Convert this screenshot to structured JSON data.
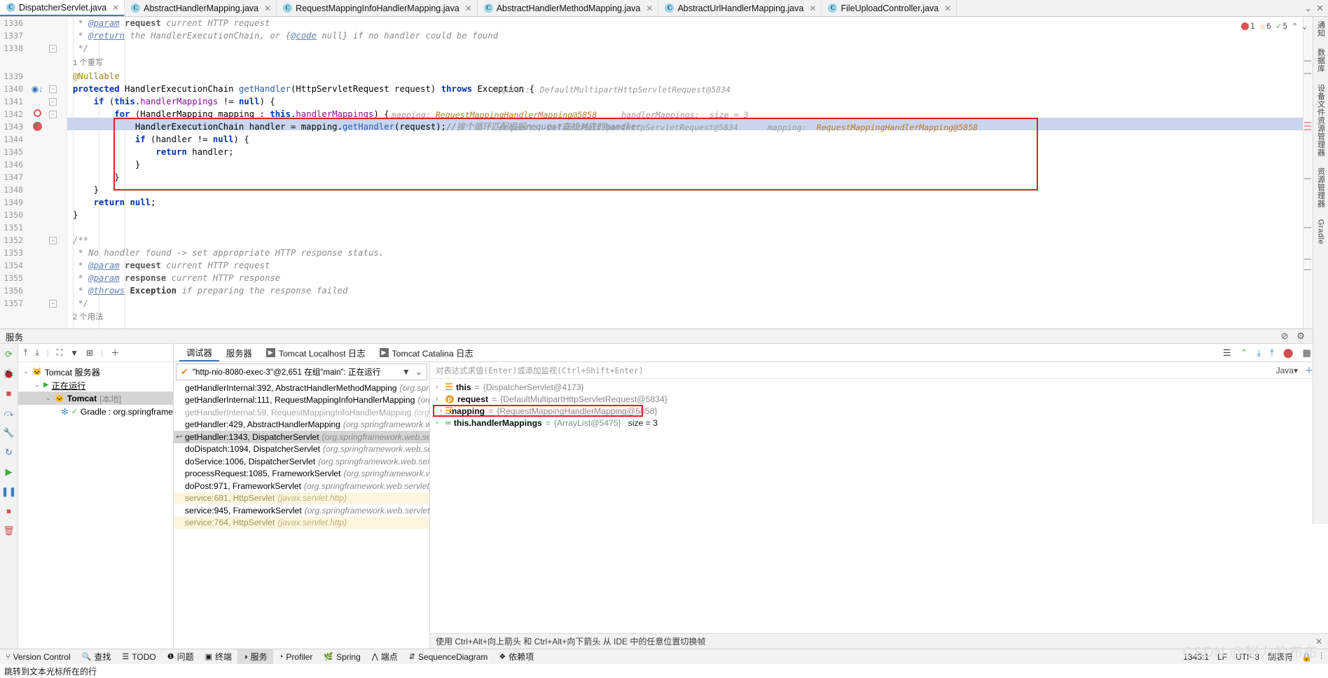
{
  "tabs": [
    {
      "label": "DispatcherServlet.java",
      "active": true
    },
    {
      "label": "AbstractHandlerMapping.java",
      "active": false
    },
    {
      "label": "RequestMappingInfoHandlerMapping.java",
      "active": false
    },
    {
      "label": "AbstractHandlerMethodMapping.java",
      "active": false
    },
    {
      "label": "AbstractUrlHandlerMapping.java",
      "active": false
    },
    {
      "label": "FileUploadController.java",
      "active": false
    }
  ],
  "inspections": {
    "errors": "1",
    "warnings": "6",
    "weak": "5",
    "up": "⌃",
    "down": "⌄"
  },
  "editor": {
    "lines": [
      {
        "no": "1336",
        "text": " * @param request current HTTP request"
      },
      {
        "no": "1337",
        "text": " * @return the HandlerExecutionChain, or {@code null} if no handler could be found"
      },
      {
        "no": "1338",
        "text": " */"
      },
      {
        "no": "",
        "text": "1 个重写"
      },
      {
        "no": "1339",
        "text": "@Nullable"
      },
      {
        "no": "1340",
        "text": "protected HandlerExecutionChain getHandler(HttpServletRequest request) throws Exception {"
      },
      {
        "no": "1341",
        "text": "if (this.handlerMappings != null) {"
      },
      {
        "no": "1342",
        "text": "for (HandlerMapping mapping : this.handlerMappings) {"
      },
      {
        "no": "1343",
        "text": "HandlerExecutionChain handler = mapping.getHandler(request);"
      },
      {
        "no": "1344",
        "text": "if (handler != null) {"
      },
      {
        "no": "1345",
        "text": "return handler;"
      },
      {
        "no": "1346",
        "text": "}"
      },
      {
        "no": "1347",
        "text": "}"
      },
      {
        "no": "1348",
        "text": "}"
      },
      {
        "no": "1349",
        "text": "return null;"
      },
      {
        "no": "1350",
        "text": "}"
      },
      {
        "no": "1351",
        "text": ""
      },
      {
        "no": "1352",
        "text": "/**"
      },
      {
        "no": "1353",
        "text": " * No handler found -> set appropriate HTTP response status."
      },
      {
        "no": "1354",
        "text": " * @param request current HTTP request"
      },
      {
        "no": "1355",
        "text": " * @param response current HTTP response"
      },
      {
        "no": "1356",
        "text": " * @throws Exception if preparing the response failed"
      },
      {
        "no": "1357",
        "text": " */"
      },
      {
        "no": "",
        "text": "2 个用法"
      }
    ],
    "override_label_1": "1 个重写",
    "usages_label": "2 个用法",
    "line1343_comment": "//挨个循环匹配根据request查找对应的handler",
    "hint_1340_request": "request:  DefaultMultipartHttpServletRequest@5834",
    "hint_1342_mapping": "mapping:  RequestMappingHandlerMapping@5858",
    "hint_1342_handlerMappings": "handlerMappings:  size = 3",
    "hint_1343_request": "request:  DefaultMultipartHttpServletRequest@5834",
    "hint_1343_mapping": "mapping:  RequestMappingHandlerMapping@5858"
  },
  "right_strip": [
    "通知",
    "数据库",
    "设备文件资源管理器",
    "资源管理器",
    "Gradle"
  ],
  "services": {
    "title": "服务",
    "tree_toolbar_icons": [
      "expand-all-icon",
      "collapse-all-icon",
      "group-icon",
      "filter-icon",
      "add-frame-icon",
      "plus-icon"
    ],
    "tree": [
      {
        "label": "Tomcat 服务器",
        "depth": 0,
        "icon": "tomcat-icon",
        "twisty": "⌄",
        "selected": false,
        "bold": false
      },
      {
        "label": "正在运行",
        "depth": 1,
        "icon": "play-icon",
        "twisty": "⌄",
        "selected": false,
        "bold": false,
        "underline": true
      },
      {
        "label": "Tomcat",
        "suffix": "[本地]",
        "depth": 2,
        "icon": "tomcat-icon",
        "twisty": "⌄",
        "selected": true,
        "bold": true
      },
      {
        "label": "Gradle : org.springframe",
        "depth": 3,
        "icon": "gradle-icon",
        "twisty": "",
        "selected": false,
        "bold": false
      }
    ]
  },
  "debugger": {
    "tabs": [
      {
        "label": "调试器",
        "active": true,
        "badge": ""
      },
      {
        "label": "服务器",
        "active": false,
        "badge": ""
      },
      {
        "label": "Tomcat Localhost 日志",
        "active": false,
        "badge": "▶"
      },
      {
        "label": "Tomcat Catalina 日志",
        "active": false,
        "badge": "▶"
      }
    ],
    "thread": "\"http-nio-8080-exec-3\"@2,651 在组\"main\": 正在运行",
    "frames": [
      {
        "method": "getHandlerInternal:392, AbstractHandlerMethodMapping",
        "pkg": "(org.springfra",
        "state": "normal"
      },
      {
        "method": "getHandlerInternal:111, RequestMappingInfoHandlerMapping",
        "pkg": "(org.sprin",
        "state": "normal"
      },
      {
        "method": "getHandlerInternal:59, RequestMappingInfoHandlerMapping",
        "pkg": "(org.sprin",
        "state": "gray"
      },
      {
        "method": "getHandler:429, AbstractHandlerMapping",
        "pkg": "(org.springframework.web.se",
        "state": "normal"
      },
      {
        "method": "getHandler:1343, DispatcherServlet",
        "pkg": "(org.springframework.web.servlet)",
        "state": "selected"
      },
      {
        "method": "doDispatch:1094, DispatcherServlet",
        "pkg": "(org.springframework.web.servlet)",
        "state": "normal"
      },
      {
        "method": "doService:1006, DispatcherServlet",
        "pkg": "(org.springframework.web.servlet)",
        "state": "normal"
      },
      {
        "method": "processRequest:1085, FrameworkServlet",
        "pkg": "(org.springframework.web.ser",
        "state": "normal"
      },
      {
        "method": "doPost:971, FrameworkServlet",
        "pkg": "(org.springframework.web.servlet)",
        "state": "normal"
      },
      {
        "method": "service:681, HttpServlet",
        "pkg": "(javax.servlet.http)",
        "state": "yellow"
      },
      {
        "method": "service:945, FrameworkServlet",
        "pkg": "(org.springframework.web.servlet)",
        "state": "normal"
      },
      {
        "method": "service:764, HttpServlet",
        "pkg": "(javax.servlet.http)",
        "state": "yellow"
      }
    ],
    "eval_placeholder": "对表达式求值(Enter)或添加监视(Ctrl+Shift+Enter)",
    "eval_lang": "Java",
    "variables": [
      {
        "name": "this",
        "eq": "=",
        "value": "{DispatcherServlet@4173}",
        "icon": "object-icon",
        "extra": "",
        "boxed": false
      },
      {
        "name": "request",
        "eq": "=",
        "value": "{DefaultMultipartHttpServletRequest@5834}",
        "icon": "parameter-icon",
        "extra": "",
        "boxed": false
      },
      {
        "name": "mapping",
        "eq": "=",
        "value": "{RequestMappingHandlerMapping@5858}",
        "icon": "object-icon",
        "extra": "",
        "boxed": true
      },
      {
        "name": "this.handlerMappings",
        "eq": "=",
        "value": "{ArrayList@5475}",
        "icon": "watch-icon",
        "extra": "size = 3",
        "boxed": false
      }
    ],
    "footer_hint": "使用 Ctrl+Alt+向上箭头 和 Ctrl+Alt+向下箭头 从 IDE 中的任意位置切换帧"
  },
  "statusbar": {
    "items": [
      {
        "label": "Version Control",
        "icon": "branch-icon",
        "active": false
      },
      {
        "label": "查找",
        "icon": "search-icon",
        "active": false
      },
      {
        "label": "TODO",
        "icon": "list-icon",
        "active": false
      },
      {
        "label": "问题",
        "icon": "warning-icon",
        "active": false
      },
      {
        "label": "终端",
        "icon": "terminal-icon",
        "active": false
      },
      {
        "label": "服务",
        "icon": "services-icon",
        "active": true
      },
      {
        "label": "Profiler",
        "icon": "profiler-icon",
        "active": false
      },
      {
        "label": "Spring",
        "icon": "spring-icon",
        "active": false
      },
      {
        "label": "端点",
        "icon": "endpoints-icon",
        "active": false
      },
      {
        "label": "SequenceDiagram",
        "icon": "sequence-icon",
        "active": false
      },
      {
        "label": "依赖项",
        "icon": "dependencies-icon",
        "active": false
      }
    ],
    "caret": "1343:1",
    "line_sep": "LF",
    "encoding": "UTF-8",
    "indent": "制表符",
    "lock": "🔒",
    "bottom_message": "跳转到文本光标所在的行"
  },
  "watermark": "CSDN @努力的布布"
}
